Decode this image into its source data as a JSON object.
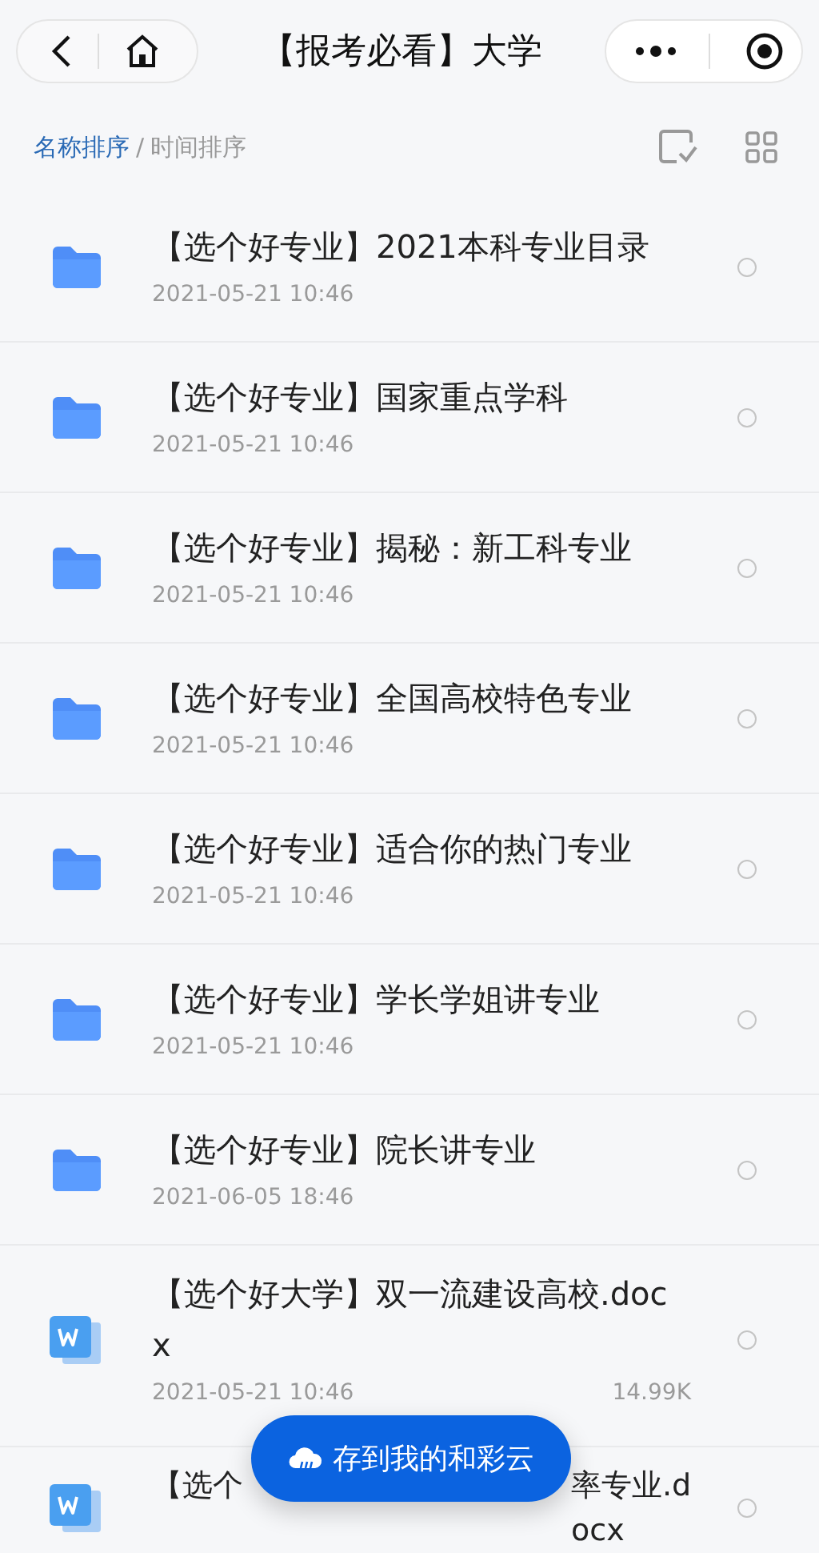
{
  "title": "【报考必看】大学",
  "sort_options": [
    {
      "label": "名称排序",
      "selected": true
    },
    {
      "label": "时间排序",
      "selected": false
    }
  ],
  "sort_separator": "/",
  "files": [
    {
      "kind": "folder",
      "name": "【选个好专业】2021本科专业目录",
      "date": "2021-05-21 10:46",
      "selected": false
    },
    {
      "kind": "folder",
      "name": "【选个好专业】国家重点学科",
      "date": "2021-05-21 10:46",
      "selected": false
    },
    {
      "kind": "folder",
      "name": "【选个好专业】揭秘：新工科专业",
      "date": "2021-05-21 10:46",
      "selected": false
    },
    {
      "kind": "folder",
      "name": "【选个好专业】全国高校特色专业",
      "date": "2021-05-21 10:46",
      "selected": false
    },
    {
      "kind": "folder",
      "name": "【选个好专业】适合你的热门专业",
      "date": "2021-05-21 10:46",
      "selected": false
    },
    {
      "kind": "folder",
      "name": "【选个好专业】学长学姐讲专业",
      "date": "2021-05-21 10:46",
      "selected": false
    },
    {
      "kind": "folder",
      "name": "【选个好专业】院长讲专业",
      "date": "2021-06-05 18:46",
      "selected": false
    },
    {
      "kind": "doc",
      "name": "【选个好大学】双一流建设高校.docx",
      "date": "2021-05-21 10:46",
      "size": "14.99K",
      "selected": false
    },
    {
      "kind": "doc",
      "name_start": "【选个",
      "name_end": "率专业.docx",
      "selected": false
    }
  ],
  "save_button": "存到我的和彩云"
}
